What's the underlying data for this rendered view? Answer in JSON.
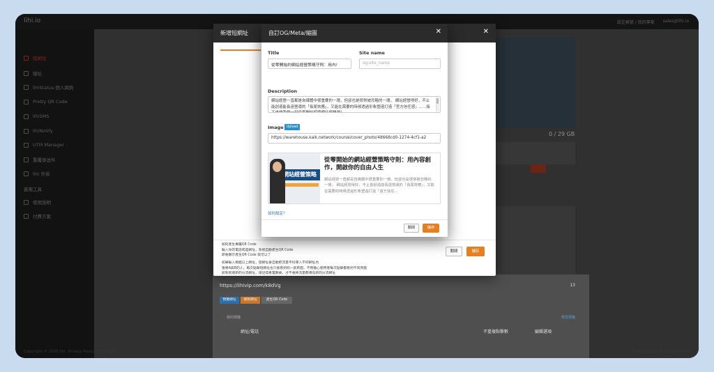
{
  "app": {
    "brand": "lihi.io",
    "top_right": [
      "設定帳號 / 我的專案",
      "sales@lihi.io"
    ]
  },
  "sidebar": {
    "items": [
      {
        "label": "短網址",
        "active": true
      },
      {
        "label": "縮址"
      },
      {
        "label": "lihiStatus 個人網頁"
      },
      {
        "label": "Pretty QR Code"
      },
      {
        "label": "lihiSMS"
      },
      {
        "label": "lihiNotify"
      },
      {
        "label": "UTM Manager"
      },
      {
        "label": "重覆發送件"
      },
      {
        "label": "lihi 外掛"
      }
    ],
    "section_title": "進階工具",
    "section_items": [
      {
        "label": "使用說明"
      },
      {
        "label": "付費方案"
      }
    ]
  },
  "footer": {
    "copyright": "Copyright © 2020 lihi",
    "links": [
      "Privacy Policy",
      "TOS",
      "SLA"
    ],
    "right": "利庫網路有限公司 TW 42040411"
  },
  "background": {
    "storage": "0 / 29 GB",
    "lower_url": "https://lihivip.com/k8dVg",
    "click_count": "13",
    "tags_label": "我的標籤",
    "edit_tags": "修改標籤",
    "col_url": "網址/電話",
    "col_unique": "不重複點擊數",
    "col_edit": "編輯選項",
    "chips": [
      "預覽網址",
      "複製網址",
      "產生QR Code"
    ]
  },
  "modal_outer": {
    "title": "新增短網址",
    "notes": [
      "如何產生專屬QR Code",
      "輸入你的電話或是網址，系統自動產生QR Code",
      "即會顯示產生QR Code 就可以了",
      "如果輸入兩組以上網址，短網址會自動把流量平均導入不同網址內",
      "會將A與B的人，再次點擊短網址也只會看到同一張頁面，不用擔心使用者每次點擊都看到不同頁面",
      "如有新增新的分流網址，請記得重置數據，才不會將流量都導向新的分流網址"
    ],
    "btn_close": "關閉",
    "btn_save": "儲存"
  },
  "modal_og": {
    "title": "自訂OG/Meta/縮圖",
    "title_label": "Title",
    "title_value": "從零開始的網站經營策略守則：用內!",
    "sitename_label": "Site name",
    "sitename_placeholder": "og:site_name",
    "description_label": "Description",
    "description_value": "網站經營一直都是自媒體中很重要的一環，但卻也是很常被忽略的一環。 網站經營得好，不止能創造能長遠營運的「長尾效應」，又能在需要的時候透過形象塑造打造「官方信任感」......接下來讓我們一起從零開始認識網站經營吧！",
    "image_label": "Image",
    "upload_label": "Upload",
    "image_url": "https://warehouse.kaik.network/course/cover_photo/48668cd0-1274-4cf1-a2",
    "preview_title": "從零開始的網站經營策略守則：用內容創作，開啟你的自由人生",
    "preview_desc": "網站經營一直都是自媒體中很重要的一環，但卻也是很常被忽略的一環。 網站經營得好，不止能創造能長遠營運的「長尾效應」，又能在需要的時候透過形象塑造打造「官方信任...",
    "preview_image_text": "網站經營策略",
    "howto": "如何設定？",
    "btn_close": "關閉",
    "btn_save": "儲存"
  }
}
